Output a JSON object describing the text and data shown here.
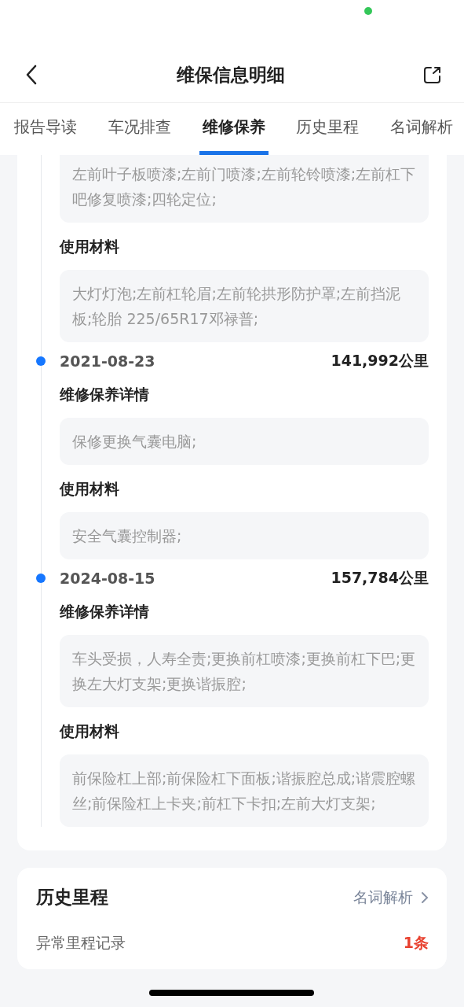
{
  "nav": {
    "title": "维保信息明细"
  },
  "tabs": [
    {
      "label": "报告导读",
      "selected": false
    },
    {
      "label": "车况排查",
      "selected": false
    },
    {
      "label": "维修保养",
      "selected": true
    },
    {
      "label": "历史里程",
      "selected": false
    },
    {
      "label": "名词解析",
      "selected": false
    }
  ],
  "records": [
    {
      "sections": [
        {
          "text": "左前叶子板喷漆;左前门喷漆;左前轮铃喷漆;左前杠下吧修复喷漆;四轮定位;"
        },
        {
          "label": "使用材料",
          "text": "大灯灯泡;左前杠轮眉;左前轮拱形防护罩;左前挡泥板;轮胎 225/65R17邓禄普;"
        }
      ]
    },
    {
      "date": "2021-08-23",
      "mileage": "141,992公里",
      "sections": [
        {
          "label": "维修保养详情",
          "text": "保修更换气囊电脑;"
        },
        {
          "label": "使用材料",
          "text": "安全气囊控制器;"
        }
      ]
    },
    {
      "date": "2024-08-15",
      "mileage": "157,784公里",
      "sections": [
        {
          "label": "维修保养详情",
          "text": "车头受损，人寿全责;更换前杠喷漆;更换前杠下巴;更换左大灯支架;更换谐振腔;"
        },
        {
          "label": "使用材料",
          "text": "前保险杠上部;前保险杠下面板;谐振腔总成;谐震腔螺丝;前保险杠上卡夹;前杠下卡扣;左前大灯支架;"
        }
      ]
    }
  ],
  "mileage_card": {
    "title": "历史里程",
    "link": "名词解析",
    "rows": [
      {
        "label": "异常里程记录",
        "value": "1条"
      }
    ]
  }
}
